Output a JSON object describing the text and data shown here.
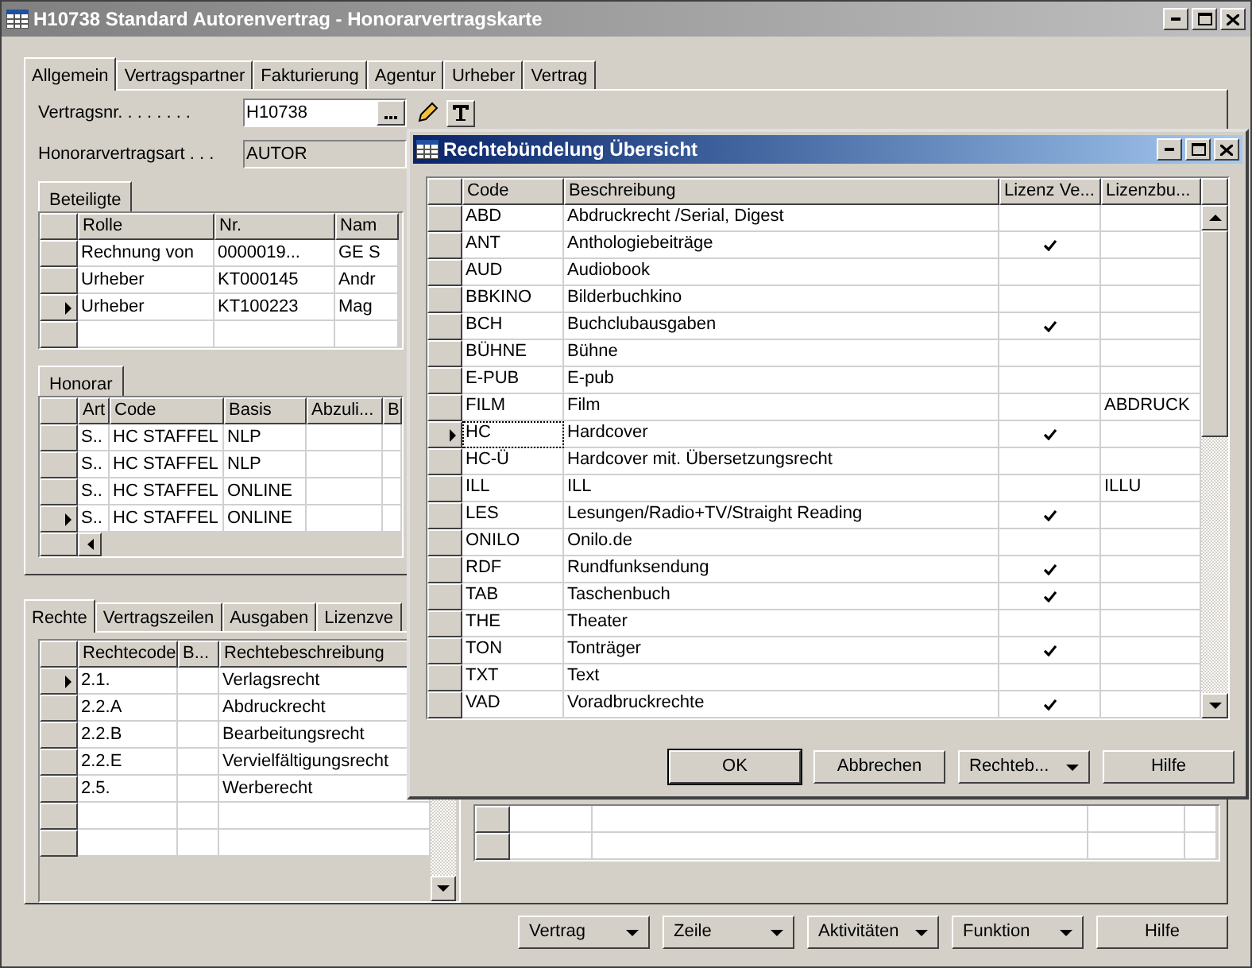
{
  "window": {
    "title": "H10738 Standard Autorenvertrag - Honorarvertragskarte"
  },
  "tabs": [
    {
      "label": "Allgemein",
      "selected": true
    },
    {
      "label": "Vertragspartner",
      "selected": false
    },
    {
      "label": "Fakturierung",
      "selected": false
    },
    {
      "label": "Agentur",
      "selected": false
    },
    {
      "label": "Urheber",
      "selected": false
    },
    {
      "label": "Vertrag",
      "selected": false
    }
  ],
  "fields": [
    {
      "label": "Vertragsnr. . . . . . . .",
      "value": "H10738",
      "kind": "lookup"
    },
    {
      "label": "Honorarvertragsart . . .",
      "value": "AUTOR",
      "kind": "readonly"
    }
  ],
  "beteiligte": {
    "tab": "Beteiligte",
    "columns": [
      "Rolle",
      "Nr.",
      "Nam"
    ],
    "rows": [
      {
        "cells": [
          "Rechnung von",
          "0000019...",
          "GE S"
        ],
        "current": false
      },
      {
        "cells": [
          "Urheber",
          "KT000145",
          "Andr"
        ],
        "current": false
      },
      {
        "cells": [
          "Urheber",
          "KT100223",
          "Mag"
        ],
        "current": true
      }
    ]
  },
  "honorar": {
    "tab": "Honorar",
    "columns": [
      "Art",
      "Code",
      "Basis",
      "Abzuli...",
      "B"
    ],
    "rows": [
      {
        "cells": [
          "S..",
          "HC STAFFEL",
          "NLP",
          null,
          null
        ],
        "current": false
      },
      {
        "cells": [
          "S..",
          "HC STAFFEL",
          "NLP",
          null,
          null
        ],
        "current": false
      },
      {
        "cells": [
          "S..",
          "HC STAFFEL",
          "ONLINE",
          null,
          null
        ],
        "current": false
      },
      {
        "cells": [
          "S..",
          "HC STAFFEL",
          "ONLINE",
          null,
          null
        ],
        "current": true
      }
    ]
  },
  "lower_tabs": [
    {
      "label": "Rechte",
      "selected": true
    },
    {
      "label": "Vertragszeilen",
      "selected": false
    },
    {
      "label": "Ausgaben",
      "selected": false
    },
    {
      "label": "Lizenzve",
      "selected": false
    }
  ],
  "rechte": {
    "columns": [
      "Rechtecode",
      "B...",
      "Rechtebeschreibung"
    ],
    "rows": [
      {
        "cells": [
          "2.1.",
          null,
          "Verlagsrecht"
        ],
        "current": true
      },
      {
        "cells": [
          "2.2.A",
          null,
          "Abdruckrecht"
        ],
        "current": false
      },
      {
        "cells": [
          "2.2.B",
          null,
          "Bearbeitungsrecht"
        ],
        "current": false
      },
      {
        "cells": [
          "2.2.E",
          null,
          "Vervielfältigungsrecht"
        ],
        "current": false
      },
      {
        "cells": [
          "2.5.",
          null,
          "Werberecht"
        ],
        "current": false
      }
    ]
  },
  "buttons": [
    {
      "label": "Vertrag",
      "kind": "dropdown"
    },
    {
      "label": "Zeile",
      "kind": "dropdown"
    },
    {
      "label": "Aktivitäten",
      "kind": "dropdown"
    },
    {
      "label": "Funktion",
      "kind": "dropdown"
    },
    {
      "label": "Hilfe",
      "kind": "button"
    }
  ],
  "dialog": {
    "title": "Rechtebündelung Übersicht",
    "columns": [
      "Code",
      "Beschreibung",
      "Lizenz Ve...",
      "Lizenzbu..."
    ],
    "rows": [
      {
        "code": "ABD",
        "beschreibung": "Abdruckrecht /Serial, Digest",
        "lizenz": false,
        "current": false
      },
      {
        "code": "ANT",
        "beschreibung": "Anthologiebeiträge",
        "lizenz": true,
        "current": false
      },
      {
        "code": "AUD",
        "beschreibung": "Audiobook",
        "lizenz": false,
        "current": false
      },
      {
        "code": "BBKINO",
        "beschreibung": "Bilderbuchkino",
        "lizenz": false,
        "current": false
      },
      {
        "code": "BCH",
        "beschreibung": "Buchclubausgaben",
        "lizenz": true,
        "current": false
      },
      {
        "code": "BÜHNE",
        "beschreibung": "Bühne",
        "lizenz": false,
        "current": false
      },
      {
        "code": "E-PUB",
        "beschreibung": "E-pub",
        "lizenz": false,
        "current": false
      },
      {
        "code": "FILM",
        "beschreibung": "Film",
        "lizenz": false,
        "lizenzbu": "ABDRUCK",
        "current": false
      },
      {
        "code": "HC",
        "beschreibung": "Hardcover",
        "lizenz": true,
        "current": true
      },
      {
        "code": "HC-Ü",
        "beschreibung": "Hardcover mit. Übersetzungsrecht",
        "lizenz": false,
        "current": false
      },
      {
        "code": "ILL",
        "beschreibung": "ILL",
        "lizenz": false,
        "lizenzbu": "ILLU",
        "current": false
      },
      {
        "code": "LES",
        "beschreibung": "Lesungen/Radio+TV/Straight Reading",
        "lizenz": true,
        "current": false
      },
      {
        "code": "ONILO",
        "beschreibung": "Onilo.de",
        "lizenz": false,
        "current": false
      },
      {
        "code": "RDF",
        "beschreibung": "Rundfunksendung",
        "lizenz": true,
        "current": false
      },
      {
        "code": "TAB",
        "beschreibung": "Taschenbuch",
        "lizenz": true,
        "current": false
      },
      {
        "code": "THE",
        "beschreibung": "Theater",
        "lizenz": false,
        "current": false
      },
      {
        "code": "TON",
        "beschreibung": "Tonträger",
        "lizenz": true,
        "current": false
      },
      {
        "code": "TXT",
        "beschreibung": "Text",
        "lizenz": false,
        "current": false
      },
      {
        "code": "VAD",
        "beschreibung": "Voradbruckrechte",
        "lizenz": true,
        "current": false
      }
    ],
    "buttons": [
      {
        "label": "OK",
        "kind": "default"
      },
      {
        "label": "Abbrechen",
        "kind": "button"
      },
      {
        "label": "Rechteb...",
        "kind": "dropdown"
      },
      {
        "label": "Hilfe",
        "kind": "button"
      }
    ]
  }
}
